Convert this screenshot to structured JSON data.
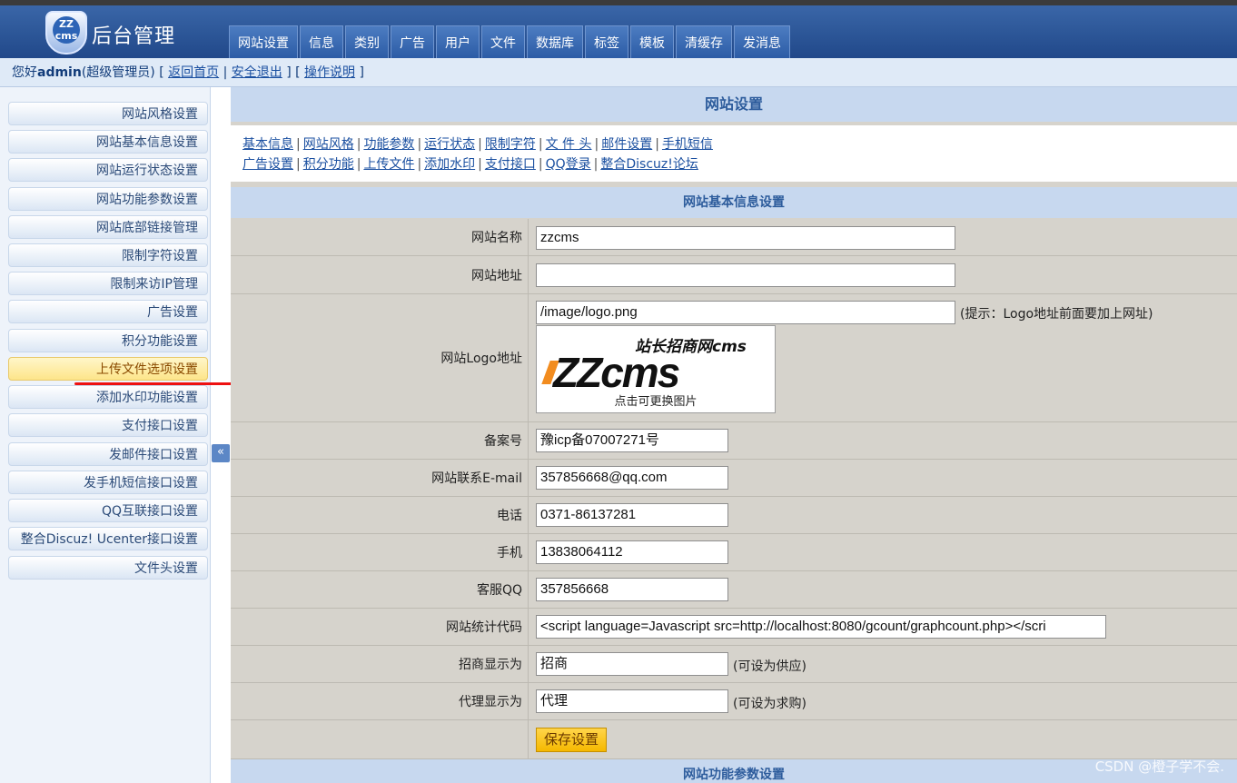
{
  "header": {
    "logo_text": "ZZ cms",
    "brand": "后台管理",
    "nav": [
      "网站设置",
      "信息",
      "类别",
      "广告",
      "用户",
      "文件",
      "数据库",
      "标签",
      "模板",
      "清缓存",
      "发消息"
    ]
  },
  "userbar": {
    "greeting": "您好",
    "username": "admin",
    "role": "(超级管理员)",
    "links": [
      "返回首页",
      "安全退出",
      "操作说明"
    ]
  },
  "sidebar": {
    "items": [
      "网站风格设置",
      "网站基本信息设置",
      "网站运行状态设置",
      "网站功能参数设置",
      "网站底部链接管理",
      "限制字符设置",
      "限制来访IP管理",
      "广告设置",
      "积分功能设置",
      "上传文件选项设置",
      "添加水印功能设置",
      "支付接口设置",
      "发邮件接口设置",
      "发手机短信接口设置",
      "QQ互联接口设置",
      "整合Discuz! Ucenter接口设置",
      "文件头设置"
    ],
    "active_index": 9,
    "collapse": "«"
  },
  "main": {
    "title": "网站设置",
    "links_row1": [
      "基本信息",
      "网站风格",
      "功能参数",
      "运行状态",
      "限制字符",
      "文 件 头",
      "邮件设置",
      "手机短信"
    ],
    "links_row2": [
      "广告设置",
      "积分功能",
      "上传文件",
      "添加水印",
      "支付接口",
      "QQ登录",
      "整合Discuz!论坛"
    ],
    "section1": "网站基本信息设置",
    "section2": "网站功能参数设置",
    "fields": {
      "site_name": {
        "label": "网站名称",
        "value": "zzcms"
      },
      "site_url": {
        "label": "网站地址",
        "value": ""
      },
      "logo": {
        "label": "网站Logo地址",
        "value": "/image/logo.png",
        "hint": "(提示：Logo地址前面要加上网址)",
        "logo_big": "ZZcms",
        "logo_cn": "站长招商网cms",
        "caption": "点击可更换图片"
      },
      "icp": {
        "label": "备案号",
        "value": "豫icp备07007271号"
      },
      "email": {
        "label": "网站联系E-mail",
        "value": "357856668@qq.com"
      },
      "phone": {
        "label": "电话",
        "value": "0371-86137281"
      },
      "mobile": {
        "label": "手机",
        "value": "13838064112"
      },
      "qq": {
        "label": "客服QQ",
        "value": "357856668"
      },
      "stats": {
        "label": "网站统计代码",
        "value": "<script language=Javascript src=http://localhost:8080/gcount/graphcount.php></scri"
      },
      "zhaoshang": {
        "label": "招商显示为",
        "value": "招商",
        "hint": "(可设为供应)"
      },
      "daili": {
        "label": "代理显示为",
        "value": "代理",
        "hint": "(可设为求购)"
      }
    },
    "save_label": "保存设置"
  },
  "watermark": "CSDN @橙子学不会."
}
